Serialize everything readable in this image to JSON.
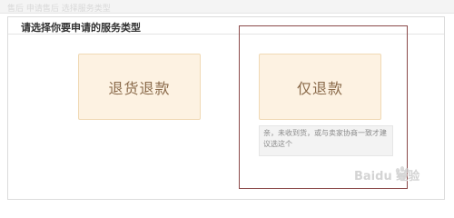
{
  "header": {
    "blur_text": "售后   申请售后   选择服务类型"
  },
  "panel": {
    "title": "请选择你要申请的服务类型"
  },
  "options": [
    {
      "label": "退货退款",
      "selected": false
    },
    {
      "label": "仅退款",
      "selected": true
    }
  ],
  "tip": {
    "text": "亲，未收到货，或与卖家协商一致才建议选这个"
  },
  "watermark": {
    "text": "Baidu 经验"
  },
  "colors": {
    "card_bg": "#fdf2e2",
    "card_text": "#8a6a4a",
    "selected_border": "#8b4a4a"
  }
}
